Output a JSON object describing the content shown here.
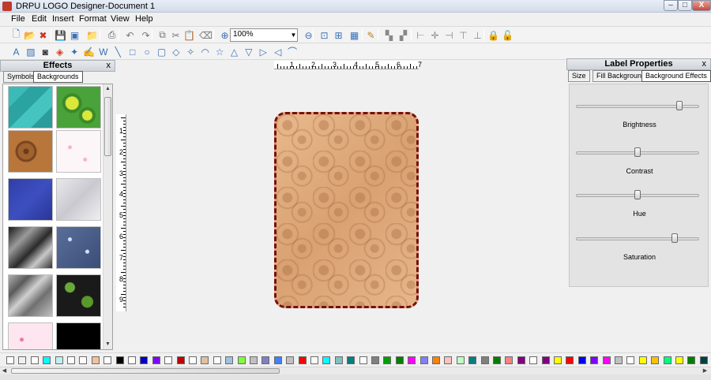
{
  "window": {
    "title": "DRPU LOGO Designer-Document 1",
    "min": "–",
    "max": "□",
    "close": "X"
  },
  "menu": [
    "File",
    "Edit",
    "Insert",
    "Format",
    "View",
    "Help"
  ],
  "toolbar": {
    "zoom_value": "100%"
  },
  "effects_panel": {
    "title": "Effects",
    "close": "x",
    "tabs": [
      "Symbols",
      "Backgrounds"
    ],
    "active_tab": "Backgrounds"
  },
  "ruler": {
    "h_ticks": [
      "1",
      "2",
      "3",
      "4",
      "5",
      "6",
      "7"
    ],
    "v_ticks": [
      "1",
      "2",
      "3",
      "4",
      "5",
      "6",
      "7",
      "8",
      "9"
    ]
  },
  "label_properties": {
    "title": "Label Properties",
    "close": "x",
    "tabs": [
      "Size",
      "Fill Background",
      "Background Effects"
    ],
    "active_tab": "Background Effects",
    "sliders": [
      {
        "label": "Brightness",
        "value": 0.86
      },
      {
        "label": "Contrast",
        "value": 0.5
      },
      {
        "label": "Hue",
        "value": 0.5
      },
      {
        "label": "Saturation",
        "value": 0.82
      }
    ]
  },
  "palette": [
    "#ffffff",
    "#f0f0f0",
    "#ffffff",
    "#00ffff",
    "#c0f0f0",
    "#ffffff",
    "#ffffff",
    "#f0c0a0",
    "#ffffff",
    "#000000",
    "#ffffff",
    "#0000c0",
    "#8000ff",
    "#ffffff",
    "#c00000",
    "#ffffff",
    "#e0c0a0",
    "#ffffff",
    "#a0c0e0",
    "#80ff40",
    "#c0c0c0",
    "#8080c0",
    "#4080ff",
    "#c0c0c0",
    "#ff0000",
    "#ffffff",
    "#00ffff",
    "#80c0c0",
    "#008080",
    "#ffffff",
    "#808080",
    "#00a000",
    "#008000",
    "#ff00ff",
    "#8080ff",
    "#ff8000",
    "#ffc0c0",
    "#c0ffc0",
    "#008080",
    "#808080",
    "#008000",
    "#ff8080",
    "#800080",
    "#ffffff",
    "#800080",
    "#ffff00",
    "#ff0000",
    "#0000ff",
    "#8000ff",
    "#ff00ff",
    "#c0c0c0",
    "#ffffff",
    "#ffff00",
    "#ffc000",
    "#00ff80",
    "#ffff00",
    "#008000",
    "#004040"
  ],
  "icons": {
    "toolbar1": [
      "new-icon",
      "open-icon",
      "close-doc-icon",
      "save-icon",
      "save-all-icon",
      "open-folder-icon",
      "print-icon",
      "undo-icon",
      "redo-icon",
      "copy-icon",
      "cut-icon",
      "paste-icon",
      "delete-icon",
      "zoom-in-icon",
      "zoom-out-icon",
      "actual-size-icon",
      "fit-icon",
      "grid-icon",
      "edit-icon",
      "group-icon",
      "ungroup-icon",
      "align-left-icon",
      "align-center-icon",
      "align-right-icon",
      "align-top-icon",
      "align-bottom-icon",
      "lock-icon",
      "unlock-icon"
    ],
    "toolbar2": [
      "text-icon",
      "image-icon",
      "camera-icon",
      "shapes-icon",
      "symbol-icon",
      "signature-icon",
      "wordart-icon",
      "line-icon",
      "rectangle-icon",
      "ellipse-icon",
      "rounded-rect-icon",
      "diamond-icon",
      "star-icon",
      "arc-icon",
      "star5-icon",
      "triangle-icon",
      "triangle-down-icon",
      "arrow-right-icon",
      "arrow-left-icon",
      "curve-icon"
    ]
  }
}
